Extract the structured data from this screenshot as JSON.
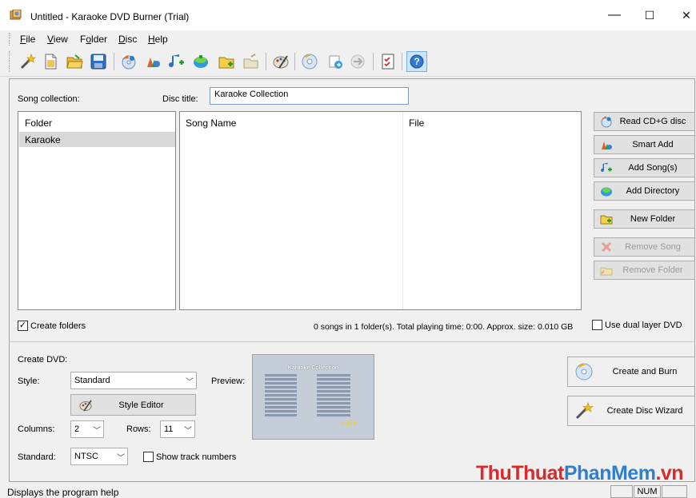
{
  "window": {
    "title": "Untitled - Karaoke DVD Burner (Trial)",
    "minimize": "—",
    "maximize": "☐",
    "close": "✕"
  },
  "menu": {
    "items": [
      {
        "label": "File",
        "accel": "F"
      },
      {
        "label": "View",
        "accel": "V"
      },
      {
        "label": "Folder",
        "accel": "o"
      },
      {
        "label": "Disc",
        "accel": "D"
      },
      {
        "label": "Help",
        "accel": "H"
      }
    ]
  },
  "toolbar": {
    "icons": [
      "wand-icon",
      "new-document-icon",
      "open-folder-icon",
      "save-icon",
      "read-cdg-icon",
      "smart-add-icon",
      "add-song-icon",
      "add-directory-icon",
      "new-folder-icon",
      "remove-folder-icon",
      "style-editor-icon",
      "burn-disc-icon",
      "import-icon",
      "export-icon",
      "checklist-icon",
      "help-icon"
    ]
  },
  "collection": {
    "song_collection_label": "Song collection:",
    "disc_title_label": "Disc title:",
    "disc_title_value": "Karaoke Collection"
  },
  "folders": {
    "header": "Folder",
    "items": [
      "Karaoke"
    ]
  },
  "songs": {
    "headers": [
      "Song Name",
      "File"
    ]
  },
  "side_buttons": {
    "read_cdg": "Read CD+G disc",
    "smart_add": "Smart Add",
    "add_songs": "Add Song(s)",
    "add_directory": "Add Directory",
    "new_folder": "New Folder",
    "remove_song": "Remove Song",
    "remove_folder": "Remove Folder"
  },
  "options": {
    "create_folders_label": "Create folders",
    "create_folders_checked": true,
    "summary": "0 songs in 1 folder(s). Total playing time: 0:00. Approx. size: 0.010 GB",
    "dual_layer_label": "Use dual layer DVD",
    "dual_layer_checked": false
  },
  "create_dvd": {
    "heading": "Create DVD:",
    "style_label": "Style:",
    "style_value": "Standard",
    "style_editor_label": "Style Editor",
    "preview_label": "Preview:",
    "columns_label": "Columns:",
    "columns_value": "2",
    "rows_label": "Rows:",
    "rows_value": "11",
    "standard_label": "Standard:",
    "standard_value": "NTSC",
    "show_track_numbers_label": "Show track numbers",
    "show_track_numbers_checked": false,
    "create_and_burn": "Create and Burn",
    "create_disc_wizard": "Create Disc Wizard"
  },
  "preview": {
    "title": "Karaoke Collection"
  },
  "status": {
    "message": "Displays the program help",
    "num": "NUM"
  },
  "watermark": {
    "part1": "ThuThuat",
    "part2": "PhanMem",
    "part3": ".vn"
  }
}
